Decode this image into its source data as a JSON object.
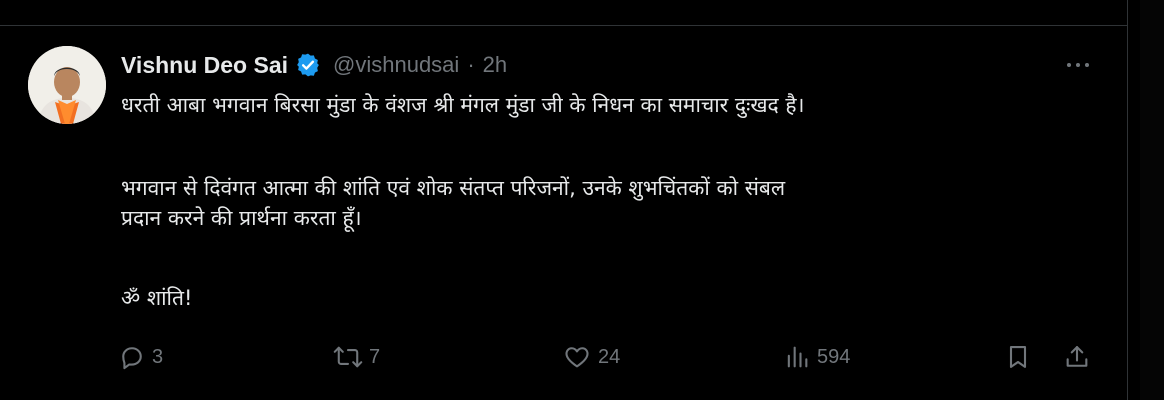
{
  "tweet": {
    "author_name": "Vishnu Deo Sai",
    "handle": "@vishnudsai",
    "separator": "·",
    "time": "2h",
    "lines": [
      "धरती आबा भगवान बिरसा मुंडा के वंशज श्री मंगल मुंडा जी के निधन का समाचार दुःखद है।",
      "भगवान से दिवंगत आत्मा की शांति एवं शोक संतप्त परिजनों, उनके शुभचिंतकों को संबल",
      "प्रदान करने की प्रार्थना करता हूँ।",
      "ॐ शांति!"
    ]
  },
  "actions": {
    "replies": "3",
    "reposts": "7",
    "likes": "24",
    "views": "594"
  },
  "icons": {
    "verified": "verified-badge-icon",
    "more": "more-dots-icon",
    "reply": "reply-icon",
    "repost": "repost-icon",
    "like": "heart-icon",
    "views": "views-chart-icon",
    "bookmark": "bookmark-icon",
    "share": "share-icon"
  },
  "colors": {
    "background": "#000000",
    "text": "#e7e9ea",
    "muted": "#71767b",
    "verified": "#1d9bf0",
    "divider": "#2f3336"
  }
}
